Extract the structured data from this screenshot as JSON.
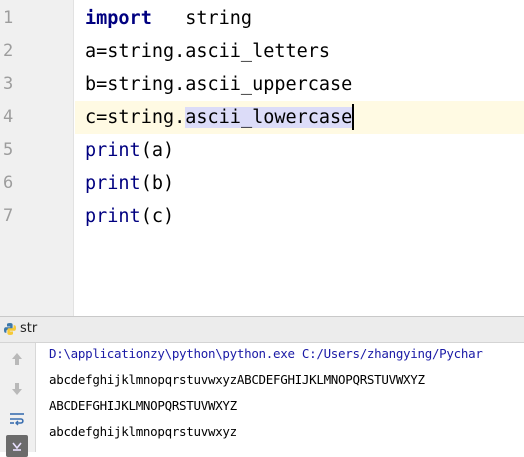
{
  "editor": {
    "line_numbers": [
      "1",
      "2",
      "3",
      "4",
      "5",
      "6",
      "7"
    ],
    "lines": [
      {
        "kw": "import",
        "rest": "   string"
      },
      {
        "text": "a=string.ascii_letters"
      },
      {
        "text": "b=string.ascii_uppercase"
      },
      {
        "prefix": "c=string.",
        "selected": "ascii_lowercase"
      },
      {
        "fn": "print",
        "arg": "(a)"
      },
      {
        "fn": "print",
        "arg": "(b)"
      },
      {
        "fn": "print",
        "arg": "(c)"
      }
    ]
  },
  "run_panel": {
    "title": "str",
    "command": "D:\\applicationzy\\python\\python.exe C:/Users/zhangying/Pychar",
    "output": [
      "abcdefghijklmnopqrstuvwxyzABCDEFGHIJKLMNOPQRSTUVWXYZ",
      "ABCDEFGHIJKLMNOPQRSTUVWXYZ",
      "abcdefghijklmnopqrstuvwxyz"
    ],
    "toolbar_icons": [
      "up-arrow-icon",
      "down-arrow-icon",
      "soft-wrap-icon",
      "scroll-to-end-icon"
    ]
  },
  "colors": {
    "keyword": "#000080",
    "current_line": "#fffae3",
    "selection": "#dcdcf8",
    "gutter": "#f0f0f0",
    "command_text": "#1a1aa6"
  }
}
